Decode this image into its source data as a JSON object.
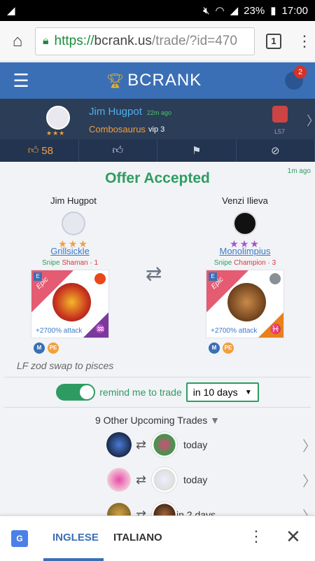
{
  "status": {
    "battery": "23%",
    "time": "17:00"
  },
  "browser": {
    "url_scheme": "https://",
    "url_host": "bcrank.us",
    "url_path": "/trade/?id=470",
    "tab_count": "1"
  },
  "nav": {
    "brand": "BCRANK",
    "notifications": "2"
  },
  "poster": {
    "name": "Jim Hugpot",
    "time": "22m ago",
    "team": "Combosaurus",
    "vip": "vip 3",
    "level": "L57",
    "stars": "★★★"
  },
  "actions": {
    "likes": "58"
  },
  "offer": {
    "title": "Offer Accepted",
    "time": "1m ago",
    "left": {
      "name": "Jim Hugpot",
      "stars": "★★★",
      "dragon": "Grillsickle",
      "snipe": "Snipe",
      "rank": "Shaman · 1",
      "attack": "+2700% attack",
      "ribbon": "Epic"
    },
    "right": {
      "name": "Venzi Ilieva",
      "stars": "★★★",
      "dragon": "Monolimpius",
      "snipe": "Snipe",
      "rank": "Champion · 3",
      "attack": "+2700% attack",
      "ribbon": "Epic"
    },
    "chips": [
      "M",
      "PE"
    ],
    "note": "LF zod swap to pisces"
  },
  "remind": {
    "label": "remind me to trade",
    "selected": "in 10 days"
  },
  "upcoming": {
    "title": "9 Other Upcoming Trades",
    "rows": [
      {
        "when": "today"
      },
      {
        "when": "today"
      },
      {
        "when": "in 2 days"
      }
    ]
  },
  "translate": {
    "lang_active": "INGLESE",
    "lang_other": "ITALIANO"
  },
  "colors": {
    "nav": "#3b6fb5",
    "userbar": "#2b3d57",
    "accent_green": "#2e9c62",
    "epic": "#e45b72"
  }
}
